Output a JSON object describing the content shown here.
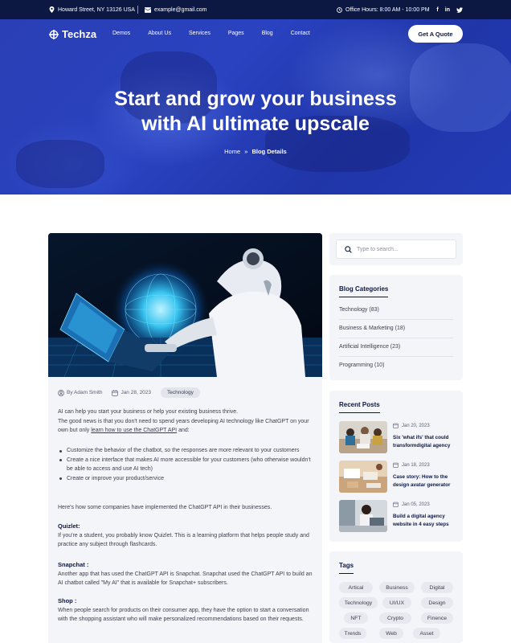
{
  "topbar": {
    "address": "Howard Street, NY 13126 USA",
    "email": "example@gmail.com",
    "hours": "Office Hours: 8:00 AM - 10:00 PM",
    "social": [
      "f",
      "in",
      "tw"
    ]
  },
  "nav": {
    "logo": "Techza",
    "links": [
      "Demos",
      "About Us",
      "Services",
      "Pages",
      "Blog",
      "Contact"
    ],
    "cta": "Get A Quote"
  },
  "hero": {
    "title_line1": "Start and grow your business",
    "title_line2": "with AI ultimate upscale",
    "breadcrumb_home": "Home",
    "breadcrumb_sep": "»",
    "breadcrumb_current": "Blog Details"
  },
  "post": {
    "author": "By Adam Smith",
    "date": "Jan 28, 2023",
    "tag": "Technology",
    "intro1": "AI can help you start your business or help your existing business thrive.",
    "intro2": "The good news is that you don't need to spend years developing AI technology like ChatGPT on your own but only ",
    "intro_link": "learn how to use the ChatGPT API",
    "intro_end": " and:",
    "bullets": [
      "Customize the behavior of the chatbot, so the responses are more relevant to your customers",
      "Create a nice interface that makes AI more accessible for your customers (who otherwise wouldn't be able to access and use AI tech)",
      "Create or improve your product/service"
    ],
    "implement": "Here's how some companies have implemented the ChatGPT API in their businesses.",
    "sections": [
      {
        "title": "Quizlet:",
        "text": "If you're a student, you probably know Quizlet. This is a learning platform that helps people study and practice any subject through flashcards."
      },
      {
        "title": "Snapchat :",
        "text": "Another app that has used the ChatGPT API is Snapchat. Snapchat used the ChatGPT API to build an AI chatbot called \"My AI\" that is available for Snapchat+ subscribers."
      },
      {
        "title": "Shop :",
        "text": "When people search for products on their consumer app, they have the option to start a conversation with the shopping assistant who will make personalized recommendations based on their requests."
      }
    ]
  },
  "sidebar": {
    "search_placeholder": "Type to search...",
    "categories_title": "Blog Categories",
    "categories": [
      "Technology (83)",
      "Business & Marketing (18)",
      "Artificial Intelligence (23)",
      "Programming (10)"
    ],
    "recent_title": "Recent Posts",
    "recent": [
      {
        "date": "Jan 20, 2023",
        "title": "Six 'what ifs' that could transformdigital agency"
      },
      {
        "date": "Jan 18, 2023",
        "title": "Case story: How to the design avatar generator"
      },
      {
        "date": "Jan 05, 2023",
        "title": "Build a digital agency website in 4 easy steps"
      }
    ],
    "tags_title": "Tags",
    "tags": [
      "Artical",
      "Business",
      "Digital",
      "Technology",
      "UI/UX",
      "Design",
      "NFT",
      "Crypto",
      "Finence",
      "Trends",
      "Web",
      "Asset"
    ]
  },
  "colors": {
    "navy": "#0c1742",
    "hero_blue": "#2a3fb5",
    "panel": "#f4f5f8"
  }
}
